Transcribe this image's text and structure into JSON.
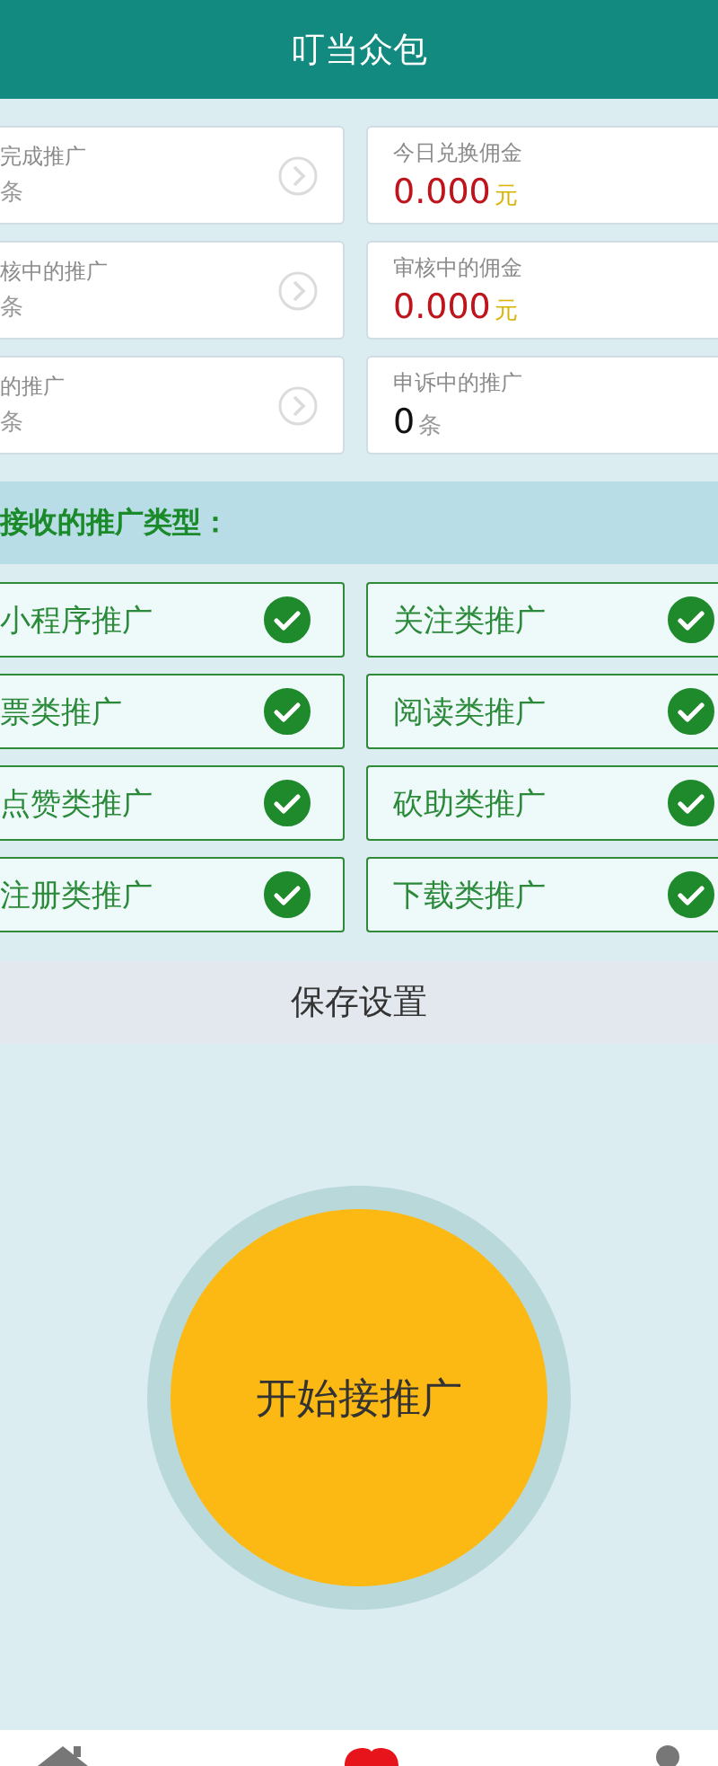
{
  "header": {
    "title": "叮当众包"
  },
  "stats": [
    {
      "kind": "link",
      "label": "完成推广",
      "unit": "条"
    },
    {
      "kind": "money",
      "label": "今日兑换佣金",
      "value": "0.000",
      "unit": "元"
    },
    {
      "kind": "link",
      "label": "核中的推广",
      "unit": "条"
    },
    {
      "kind": "money",
      "label": "审核中的佣金",
      "value": "0.000",
      "unit": "元"
    },
    {
      "kind": "link",
      "label": "的推广",
      "unit": "条"
    },
    {
      "kind": "count",
      "label": "申诉中的推广",
      "value": "0",
      "unit": "条"
    }
  ],
  "types_title": "接收的推广类型：",
  "types": [
    {
      "label": "小程序推广",
      "checked": true
    },
    {
      "label": "关注类推广",
      "checked": true
    },
    {
      "label": "票类推广",
      "checked": true
    },
    {
      "label": "阅读类推广",
      "checked": true
    },
    {
      "label": "点赞类推广",
      "checked": true
    },
    {
      "label": "砍助类推广",
      "checked": true
    },
    {
      "label": "注册类推广",
      "checked": true
    },
    {
      "label": "下载类推广",
      "checked": true
    }
  ],
  "save_button": "保存设置",
  "start_button": "开始接推广",
  "nav": [
    {
      "kind": "home",
      "selected": false
    },
    {
      "kind": "heart",
      "selected": true
    },
    {
      "kind": "person",
      "selected": false
    }
  ]
}
